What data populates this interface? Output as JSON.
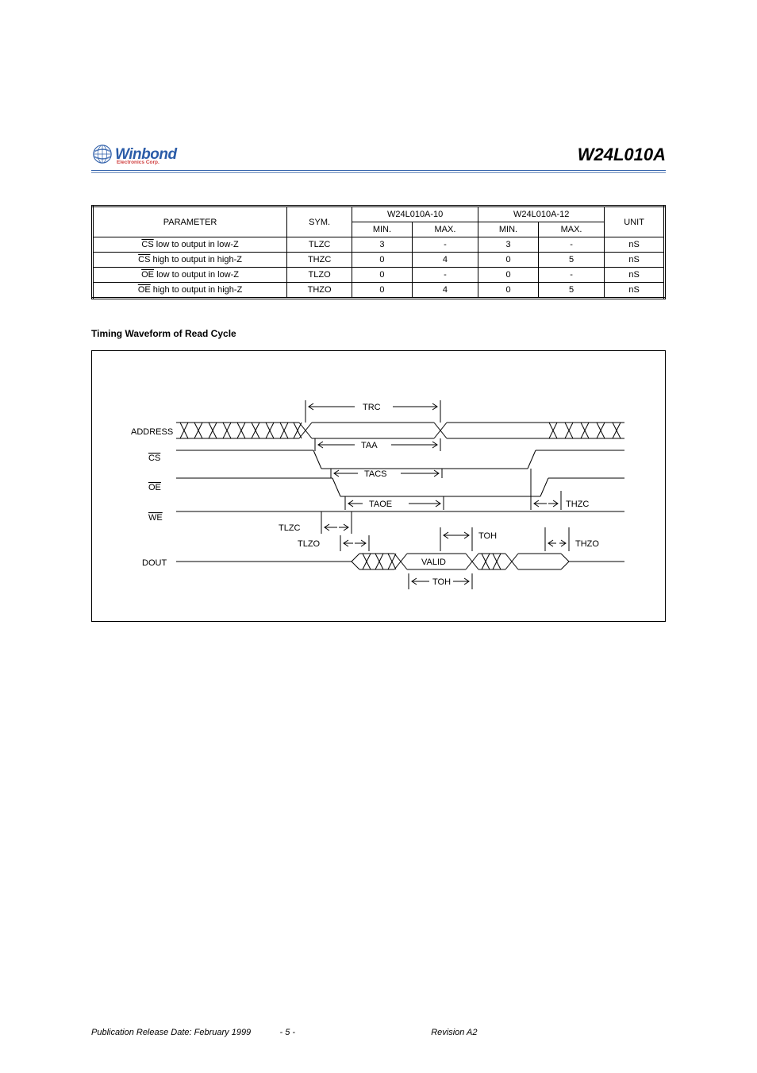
{
  "header": {
    "logo_text": "Winbond",
    "logo_sub": "Electronics Corp.",
    "part_number": "W24L010A"
  },
  "table": {
    "headers": {
      "parameter": "PARAMETER",
      "sym": "SYM.",
      "p10": "W24L010A-10",
      "p12": "W24L010A-12",
      "unit": "UNIT",
      "min": "MIN.",
      "max": "MAX."
    },
    "rows": [
      {
        "label_prefix": "CS",
        "label_rest": " low to output in low-Z",
        "sym": "TLZC",
        "min10": "3",
        "max10": "-",
        "min12": "3",
        "max12": "-",
        "unit": "nS"
      },
      {
        "label_prefix": "CS",
        "label_rest": " high to output in high-Z",
        "sym": "THZC",
        "min10": "0",
        "max10": "4",
        "min12": "0",
        "max12": "5",
        "unit": "nS"
      },
      {
        "label_prefix": "OE",
        "label_rest": " low to output in low-Z",
        "sym": "TLZO",
        "min10": "0",
        "max10": "-",
        "min12": "0",
        "max12": "-",
        "unit": "nS"
      },
      {
        "label_prefix": "OE",
        "label_rest": " high to output in high-Z",
        "sym": "THZO",
        "min10": "0",
        "max10": "4",
        "min12": "0",
        "max12": "5",
        "unit": "nS"
      }
    ]
  },
  "diagram": {
    "title": "Timing Waveform of Read Cycle",
    "labels": {
      "trc": "TRC",
      "taa": "TAA",
      "tacs": "TACS",
      "taoe": "TAOE",
      "tlzc": "TLZC",
      "tlzo": "TLZO",
      "toh": "TOH",
      "thzc": "THZC",
      "thzo": "THZO",
      "valid": "VALID"
    },
    "signals": {
      "addr": "ADDRESS",
      "cs": "CS",
      "oe": "OE",
      "we": "WE",
      "dout": "DOUT"
    }
  },
  "footer": {
    "date": "Publication Release Date: February 1999",
    "page": "- 5 -",
    "rev": "Revision A2"
  }
}
